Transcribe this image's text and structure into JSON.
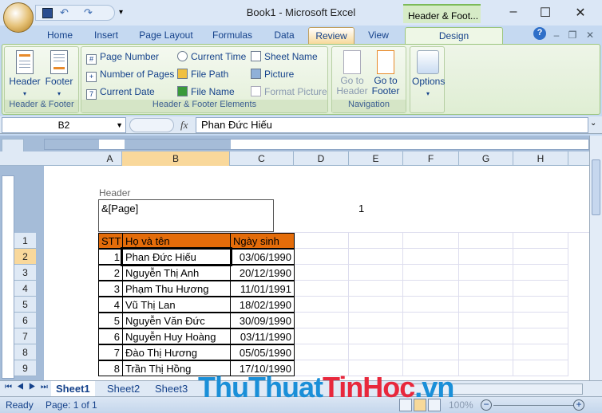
{
  "window": {
    "title": "Book1 - Microsoft Excel",
    "context_tab": "Header & Foot...",
    "minimize": "–",
    "maximize": "☐",
    "close": "✕"
  },
  "tabs": [
    {
      "label": "Home"
    },
    {
      "label": "Insert"
    },
    {
      "label": "Page Layout"
    },
    {
      "label": "Formulas"
    },
    {
      "label": "Data"
    },
    {
      "label": "Review"
    },
    {
      "label": "View"
    },
    {
      "label": "Design"
    }
  ],
  "ribbon": {
    "groups": {
      "hf": "Header & Footer",
      "elements": "Header & Footer Elements",
      "nav": "Navigation"
    },
    "header": "Header",
    "footer": "Footer",
    "page_number": "Page Number",
    "number_of_pages": "Number of Pages",
    "current_date": "Current Date",
    "current_time": "Current Time",
    "file_path": "File Path",
    "file_name": "File Name",
    "sheet_name": "Sheet Name",
    "picture": "Picture",
    "format_picture": "Format Picture",
    "goto_header": "Go to Header",
    "goto_footer": "Go to Footer",
    "options": "Options"
  },
  "formula_bar": {
    "name_box": "B2",
    "fx": "fx",
    "value": "Phan Đức Hiếu"
  },
  "columns": [
    "A",
    "B",
    "C",
    "D",
    "E",
    "F",
    "G",
    "H"
  ],
  "header_area": {
    "label": "Header",
    "left": "&[Page]",
    "center": "1"
  },
  "table": {
    "headers": [
      "STT",
      "Họ và tên",
      "Ngày sinh"
    ],
    "rows": [
      [
        "1",
        "Phan Đức Hiếu",
        "03/06/1990"
      ],
      [
        "2",
        "Nguyễn Thị Anh",
        "20/12/1990"
      ],
      [
        "3",
        "Phạm Thu Hương",
        "11/01/1991"
      ],
      [
        "4",
        "Vũ Thị Lan",
        "18/02/1990"
      ],
      [
        "5",
        "Nguyễn Văn Đức",
        "30/09/1990"
      ],
      [
        "6",
        "Nguyễn Huy Hoàng",
        "03/11/1990"
      ],
      [
        "7",
        "Đào Thị Hương",
        "05/05/1990"
      ],
      [
        "8",
        "Trần Thị Hồng",
        "17/10/1990"
      ]
    ],
    "header_color": "#E46C0A"
  },
  "row_numbers": [
    "1",
    "2",
    "3",
    "4",
    "5",
    "6",
    "7",
    "8",
    "9"
  ],
  "sheets": [
    "Sheet1",
    "Sheet2",
    "Sheet3"
  ],
  "status": {
    "ready": "Ready",
    "page": "Page: 1 of 1",
    "zoom": "100%"
  },
  "watermark": {
    "part1": "ThuThuat",
    "part2": "TinHoc",
    "part3": ".vn"
  }
}
